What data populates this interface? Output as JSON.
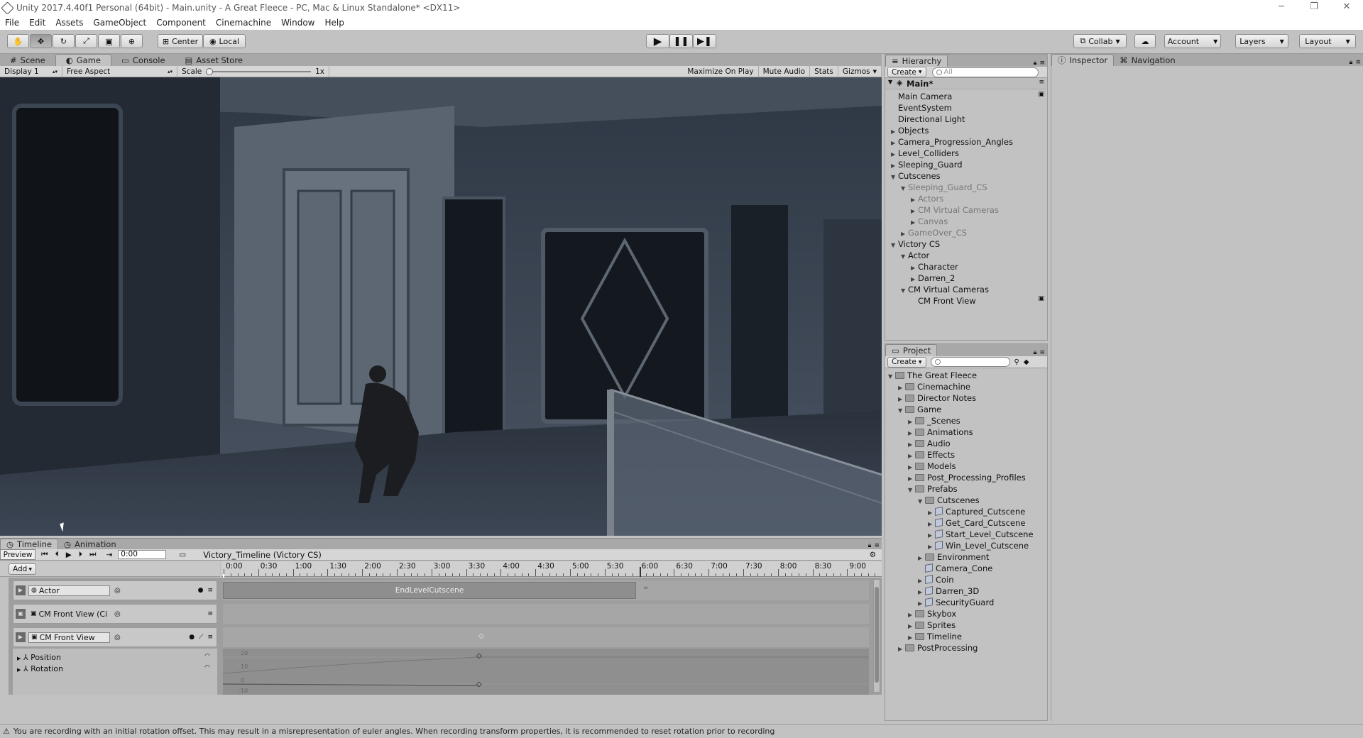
{
  "titlebar": {
    "title": "Unity 2017.4.40f1 Personal (64bit) - Main.unity - A Great Fleece - PC, Mac & Linux Standalone* <DX11>",
    "minimize": "─",
    "maximize": "❐",
    "close": "✕"
  },
  "menu": [
    "File",
    "Edit",
    "Assets",
    "GameObject",
    "Component",
    "Cinemachine",
    "Window",
    "Help"
  ],
  "toolbar": {
    "center": "Center",
    "local": "Local",
    "collab": "Collab",
    "account": "Account",
    "layers": "Layers",
    "layout": "Layout"
  },
  "scenePanel": {
    "tabs": [
      "Scene",
      "Game",
      "Console",
      "Asset Store"
    ],
    "display": "Display 1",
    "aspect": "Free Aspect",
    "scale_label": "Scale",
    "scale_value": "1x",
    "maximize": "Maximize On Play",
    "mute": "Mute Audio",
    "stats": "Stats",
    "gizmos": "Gizmos"
  },
  "hierarchy": {
    "tab": "Hierarchy",
    "create": "Create",
    "search": "All",
    "scene": "Main*",
    "rows": [
      {
        "label": "Main Camera",
        "depth": 0,
        "arrow": ""
      },
      {
        "label": "EventSystem",
        "depth": 0,
        "arrow": ""
      },
      {
        "label": "Directional Light",
        "depth": 0,
        "arrow": ""
      },
      {
        "label": "Objects",
        "depth": 0,
        "arrow": "▶"
      },
      {
        "label": "Camera_Progression_Angles",
        "depth": 0,
        "arrow": "▶"
      },
      {
        "label": "Level_Colliders",
        "depth": 0,
        "arrow": "▶"
      },
      {
        "label": "Sleeping_Guard",
        "depth": 0,
        "arrow": "▶"
      },
      {
        "label": "Cutscenes",
        "depth": 0,
        "arrow": "▼"
      },
      {
        "label": "Sleeping_Guard_CS",
        "depth": 1,
        "arrow": "▼",
        "grey": true
      },
      {
        "label": "Actors",
        "depth": 2,
        "arrow": "▶",
        "grey": true
      },
      {
        "label": "CM Virtual Cameras",
        "depth": 2,
        "arrow": "▶",
        "grey": true
      },
      {
        "label": "Canvas",
        "depth": 2,
        "arrow": "▶",
        "grey": true
      },
      {
        "label": "GameOver_CS",
        "depth": 1,
        "arrow": "▶",
        "grey": true
      },
      {
        "label": "Victory CS",
        "depth": 0,
        "arrow": "▼"
      },
      {
        "label": "Actor",
        "depth": 1,
        "arrow": "▼"
      },
      {
        "label": "Character",
        "depth": 2,
        "arrow": "▶"
      },
      {
        "label": "Darren_2",
        "depth": 2,
        "arrow": "▶"
      },
      {
        "label": "CM Virtual Cameras",
        "depth": 1,
        "arrow": "▼"
      },
      {
        "label": "CM Front View",
        "depth": 2,
        "arrow": ""
      }
    ]
  },
  "project": {
    "tab": "Project",
    "create": "Create",
    "rows": [
      {
        "label": "The Great Fleece",
        "depth": 0,
        "arrow": "▼",
        "icon": "folder"
      },
      {
        "label": "Cinemachine",
        "depth": 1,
        "arrow": "▶",
        "icon": "folder"
      },
      {
        "label": "Director Notes",
        "depth": 1,
        "arrow": "▶",
        "icon": "folder"
      },
      {
        "label": "Game",
        "depth": 1,
        "arrow": "▼",
        "icon": "folder"
      },
      {
        "label": "_Scenes",
        "depth": 2,
        "arrow": "▶",
        "icon": "folder"
      },
      {
        "label": "Animations",
        "depth": 2,
        "arrow": "▶",
        "icon": "folder"
      },
      {
        "label": "Audio",
        "depth": 2,
        "arrow": "▶",
        "icon": "folder"
      },
      {
        "label": "Effects",
        "depth": 2,
        "arrow": "▶",
        "icon": "folder"
      },
      {
        "label": "Models",
        "depth": 2,
        "arrow": "▶",
        "icon": "folder"
      },
      {
        "label": "Post_Processing_Profiles",
        "depth": 2,
        "arrow": "▶",
        "icon": "folder"
      },
      {
        "label": "Prefabs",
        "depth": 2,
        "arrow": "▼",
        "icon": "folder"
      },
      {
        "label": "Cutscenes",
        "depth": 3,
        "arrow": "▼",
        "icon": "folder"
      },
      {
        "label": "Captured_Cutscene",
        "depth": 4,
        "arrow": "▶",
        "icon": "prefab"
      },
      {
        "label": "Get_Card_Cutscene",
        "depth": 4,
        "arrow": "▶",
        "icon": "prefab"
      },
      {
        "label": "Start_Level_Cutscene",
        "depth": 4,
        "arrow": "▶",
        "icon": "prefab"
      },
      {
        "label": "Win_Level_Cutscene",
        "depth": 4,
        "arrow": "▶",
        "icon": "prefab"
      },
      {
        "label": "Environment",
        "depth": 3,
        "arrow": "▶",
        "icon": "folder"
      },
      {
        "label": "Camera_Cone",
        "depth": 3,
        "arrow": "",
        "icon": "prefab"
      },
      {
        "label": "Coin",
        "depth": 3,
        "arrow": "▶",
        "icon": "prefab"
      },
      {
        "label": "Darren_3D",
        "depth": 3,
        "arrow": "▶",
        "icon": "prefab"
      },
      {
        "label": "SecurityGuard",
        "depth": 3,
        "arrow": "▶",
        "icon": "prefab"
      },
      {
        "label": "Skybox",
        "depth": 2,
        "arrow": "▶",
        "icon": "folder"
      },
      {
        "label": "Sprites",
        "depth": 2,
        "arrow": "▶",
        "icon": "folder"
      },
      {
        "label": "Timeline",
        "depth": 2,
        "arrow": "▶",
        "icon": "folder"
      },
      {
        "label": "PostProcessing",
        "depth": 1,
        "arrow": "▶",
        "icon": "folder"
      }
    ]
  },
  "inspector": {
    "tabs": [
      "Inspector",
      "Navigation"
    ]
  },
  "timeline": {
    "tabs": [
      "Timeline",
      "Animation"
    ],
    "preview": "Preview",
    "time": "0:00",
    "asset": "Victory_Timeline (Victory CS)",
    "add": "Add",
    "ticks": [
      "0:00",
      "0:30",
      "1:00",
      "1:30",
      "2:00",
      "2:30",
      "3:00",
      "3:30",
      "4:00",
      "4:30",
      "5:00",
      "5:30",
      "6:00",
      "6:30",
      "7:00",
      "7:30",
      "8:00",
      "8:30",
      "9:00"
    ],
    "tracks": [
      {
        "name": "Actor"
      },
      {
        "name": "CM Front View (Ci"
      },
      {
        "name": "CM Front View"
      }
    ],
    "clip": "EndLevelCutscene",
    "properties": [
      "Position",
      "Rotation"
    ],
    "curve_labels": [
      "20",
      "10",
      "0",
      "-10"
    ]
  },
  "status": "You are recording with an initial rotation offset. This may result in a misrepresentation of euler angles. When recording transform properties, it is recommended to reset rotation prior to recording"
}
